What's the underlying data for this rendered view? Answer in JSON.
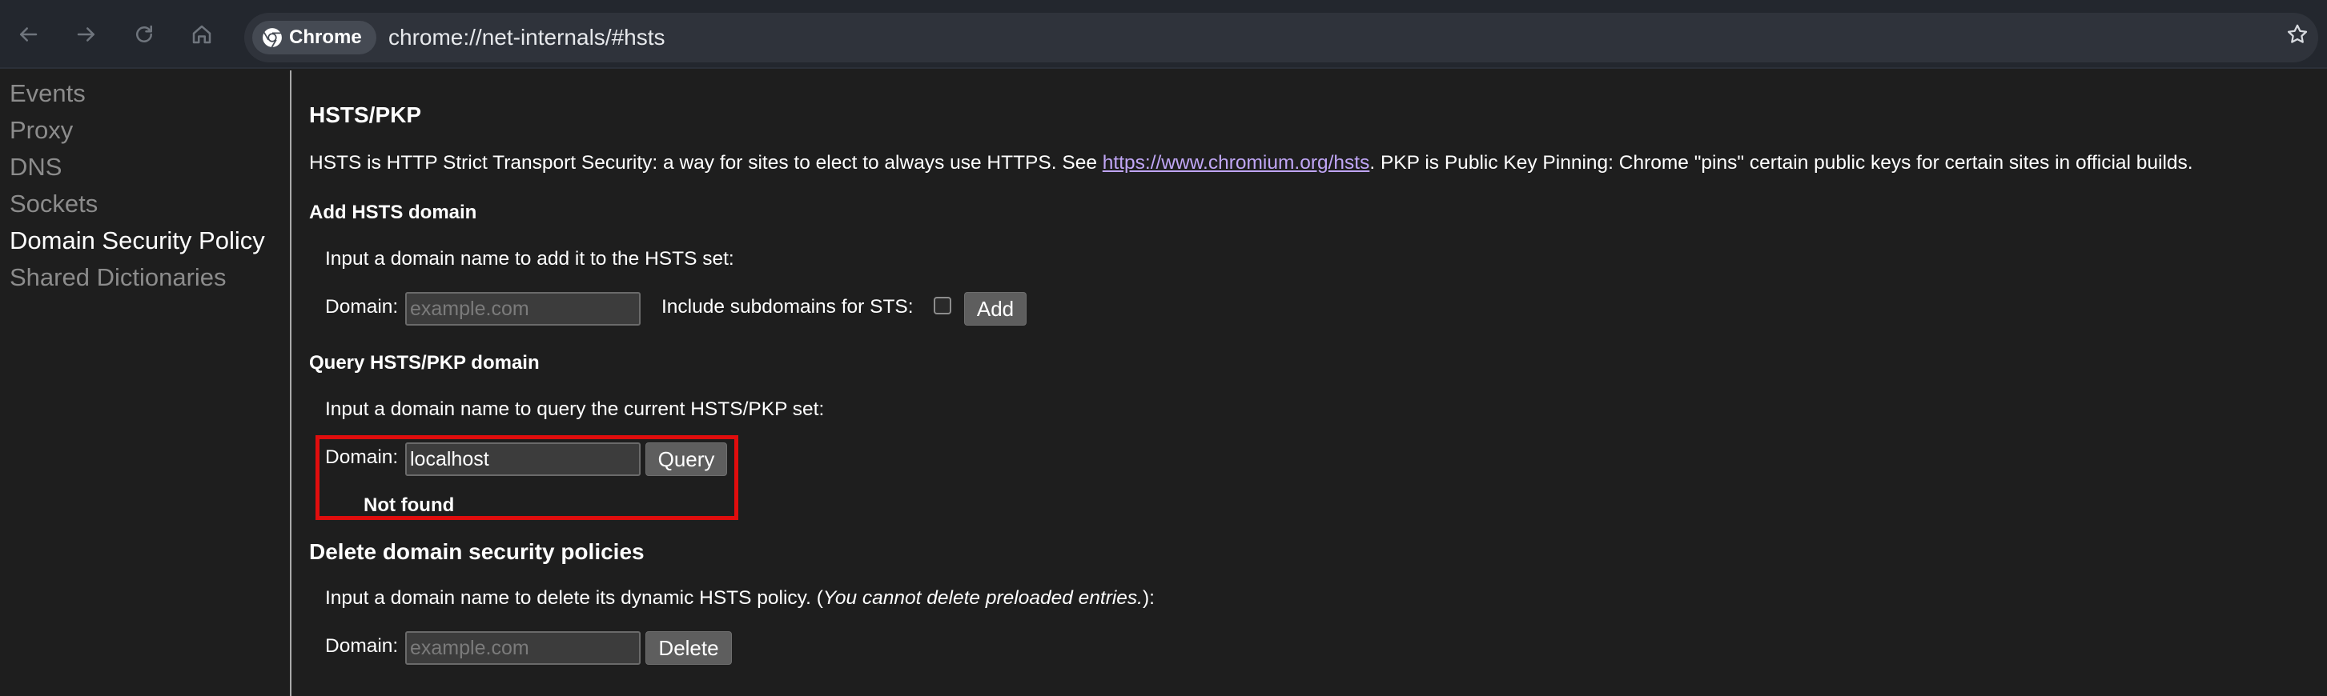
{
  "browser": {
    "chip_label": "Chrome",
    "url": "chrome://net-internals/#hsts",
    "icons": [
      "back-arrow-icon",
      "forward-arrow-icon",
      "reload-icon",
      "home-icon",
      "chrome-logo-icon",
      "bookmark-star-icon"
    ]
  },
  "sidebar": {
    "items": [
      {
        "label": "Events"
      },
      {
        "label": "Proxy"
      },
      {
        "label": "DNS"
      },
      {
        "label": "Sockets"
      },
      {
        "label": "Domain Security Policy"
      },
      {
        "label": "Shared Dictionaries"
      }
    ],
    "active": "Domain Security Policy"
  },
  "main": {
    "title": "HSTS/PKP",
    "intro_before": "HSTS is HTTP Strict Transport Security: a way for sites to elect to always use HTTPS. See ",
    "intro_link": "https://www.chromium.org/hsts",
    "intro_after": ". PKP is Public Key Pinning: Chrome \"pins\" certain public keys for certain sites in official builds.",
    "add": {
      "heading": "Add HSTS domain",
      "instruction": "Input a domain name to add it to the HSTS set:",
      "domain_label": "Domain:",
      "placeholder": "example.com",
      "include_label": "Include subdomains for STS:",
      "include_checked": false,
      "button": "Add"
    },
    "query": {
      "heading": "Query HSTS/PKP domain",
      "instruction": "Input a domain name to query the current HSTS/PKP set:",
      "domain_label": "Domain:",
      "value": "localhost",
      "button": "Query",
      "result": "Not found"
    },
    "delete": {
      "heading": "Delete domain security policies",
      "instruction_before": "Input a domain name to delete its dynamic HSTS policy. (",
      "instruction_italic": "You cannot delete preloaded entries.",
      "instruction_after": "):",
      "domain_label": "Domain:",
      "placeholder": "example.com",
      "button": "Delete"
    }
  },
  "colors": {
    "highlight": "#e00d0d",
    "link": "#c0a6f5",
    "background": "#1e1e1e"
  }
}
